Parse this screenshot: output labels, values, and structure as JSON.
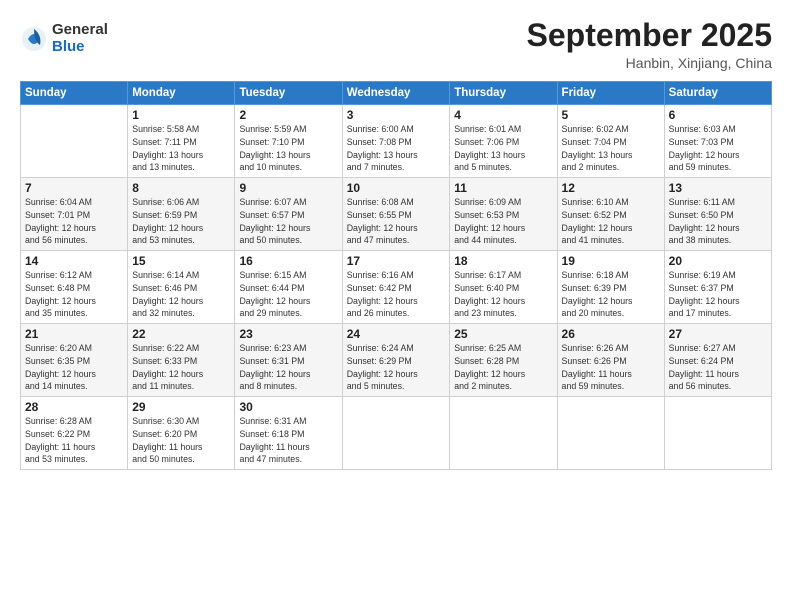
{
  "header": {
    "logo_general": "General",
    "logo_blue": "Blue",
    "month": "September 2025",
    "location": "Hanbin, Xinjiang, China"
  },
  "weekdays": [
    "Sunday",
    "Monday",
    "Tuesday",
    "Wednesday",
    "Thursday",
    "Friday",
    "Saturday"
  ],
  "weeks": [
    [
      {
        "day": "",
        "info": ""
      },
      {
        "day": "1",
        "info": "Sunrise: 5:58 AM\nSunset: 7:11 PM\nDaylight: 13 hours\nand 13 minutes."
      },
      {
        "day": "2",
        "info": "Sunrise: 5:59 AM\nSunset: 7:10 PM\nDaylight: 13 hours\nand 10 minutes."
      },
      {
        "day": "3",
        "info": "Sunrise: 6:00 AM\nSunset: 7:08 PM\nDaylight: 13 hours\nand 7 minutes."
      },
      {
        "day": "4",
        "info": "Sunrise: 6:01 AM\nSunset: 7:06 PM\nDaylight: 13 hours\nand 5 minutes."
      },
      {
        "day": "5",
        "info": "Sunrise: 6:02 AM\nSunset: 7:04 PM\nDaylight: 13 hours\nand 2 minutes."
      },
      {
        "day": "6",
        "info": "Sunrise: 6:03 AM\nSunset: 7:03 PM\nDaylight: 12 hours\nand 59 minutes."
      }
    ],
    [
      {
        "day": "7",
        "info": "Sunrise: 6:04 AM\nSunset: 7:01 PM\nDaylight: 12 hours\nand 56 minutes."
      },
      {
        "day": "8",
        "info": "Sunrise: 6:06 AM\nSunset: 6:59 PM\nDaylight: 12 hours\nand 53 minutes."
      },
      {
        "day": "9",
        "info": "Sunrise: 6:07 AM\nSunset: 6:57 PM\nDaylight: 12 hours\nand 50 minutes."
      },
      {
        "day": "10",
        "info": "Sunrise: 6:08 AM\nSunset: 6:55 PM\nDaylight: 12 hours\nand 47 minutes."
      },
      {
        "day": "11",
        "info": "Sunrise: 6:09 AM\nSunset: 6:53 PM\nDaylight: 12 hours\nand 44 minutes."
      },
      {
        "day": "12",
        "info": "Sunrise: 6:10 AM\nSunset: 6:52 PM\nDaylight: 12 hours\nand 41 minutes."
      },
      {
        "day": "13",
        "info": "Sunrise: 6:11 AM\nSunset: 6:50 PM\nDaylight: 12 hours\nand 38 minutes."
      }
    ],
    [
      {
        "day": "14",
        "info": "Sunrise: 6:12 AM\nSunset: 6:48 PM\nDaylight: 12 hours\nand 35 minutes."
      },
      {
        "day": "15",
        "info": "Sunrise: 6:14 AM\nSunset: 6:46 PM\nDaylight: 12 hours\nand 32 minutes."
      },
      {
        "day": "16",
        "info": "Sunrise: 6:15 AM\nSunset: 6:44 PM\nDaylight: 12 hours\nand 29 minutes."
      },
      {
        "day": "17",
        "info": "Sunrise: 6:16 AM\nSunset: 6:42 PM\nDaylight: 12 hours\nand 26 minutes."
      },
      {
        "day": "18",
        "info": "Sunrise: 6:17 AM\nSunset: 6:40 PM\nDaylight: 12 hours\nand 23 minutes."
      },
      {
        "day": "19",
        "info": "Sunrise: 6:18 AM\nSunset: 6:39 PM\nDaylight: 12 hours\nand 20 minutes."
      },
      {
        "day": "20",
        "info": "Sunrise: 6:19 AM\nSunset: 6:37 PM\nDaylight: 12 hours\nand 17 minutes."
      }
    ],
    [
      {
        "day": "21",
        "info": "Sunrise: 6:20 AM\nSunset: 6:35 PM\nDaylight: 12 hours\nand 14 minutes."
      },
      {
        "day": "22",
        "info": "Sunrise: 6:22 AM\nSunset: 6:33 PM\nDaylight: 12 hours\nand 11 minutes."
      },
      {
        "day": "23",
        "info": "Sunrise: 6:23 AM\nSunset: 6:31 PM\nDaylight: 12 hours\nand 8 minutes."
      },
      {
        "day": "24",
        "info": "Sunrise: 6:24 AM\nSunset: 6:29 PM\nDaylight: 12 hours\nand 5 minutes."
      },
      {
        "day": "25",
        "info": "Sunrise: 6:25 AM\nSunset: 6:28 PM\nDaylight: 12 hours\nand 2 minutes."
      },
      {
        "day": "26",
        "info": "Sunrise: 6:26 AM\nSunset: 6:26 PM\nDaylight: 11 hours\nand 59 minutes."
      },
      {
        "day": "27",
        "info": "Sunrise: 6:27 AM\nSunset: 6:24 PM\nDaylight: 11 hours\nand 56 minutes."
      }
    ],
    [
      {
        "day": "28",
        "info": "Sunrise: 6:28 AM\nSunset: 6:22 PM\nDaylight: 11 hours\nand 53 minutes."
      },
      {
        "day": "29",
        "info": "Sunrise: 6:30 AM\nSunset: 6:20 PM\nDaylight: 11 hours\nand 50 minutes."
      },
      {
        "day": "30",
        "info": "Sunrise: 6:31 AM\nSunset: 6:18 PM\nDaylight: 11 hours\nand 47 minutes."
      },
      {
        "day": "",
        "info": ""
      },
      {
        "day": "",
        "info": ""
      },
      {
        "day": "",
        "info": ""
      },
      {
        "day": "",
        "info": ""
      }
    ]
  ]
}
